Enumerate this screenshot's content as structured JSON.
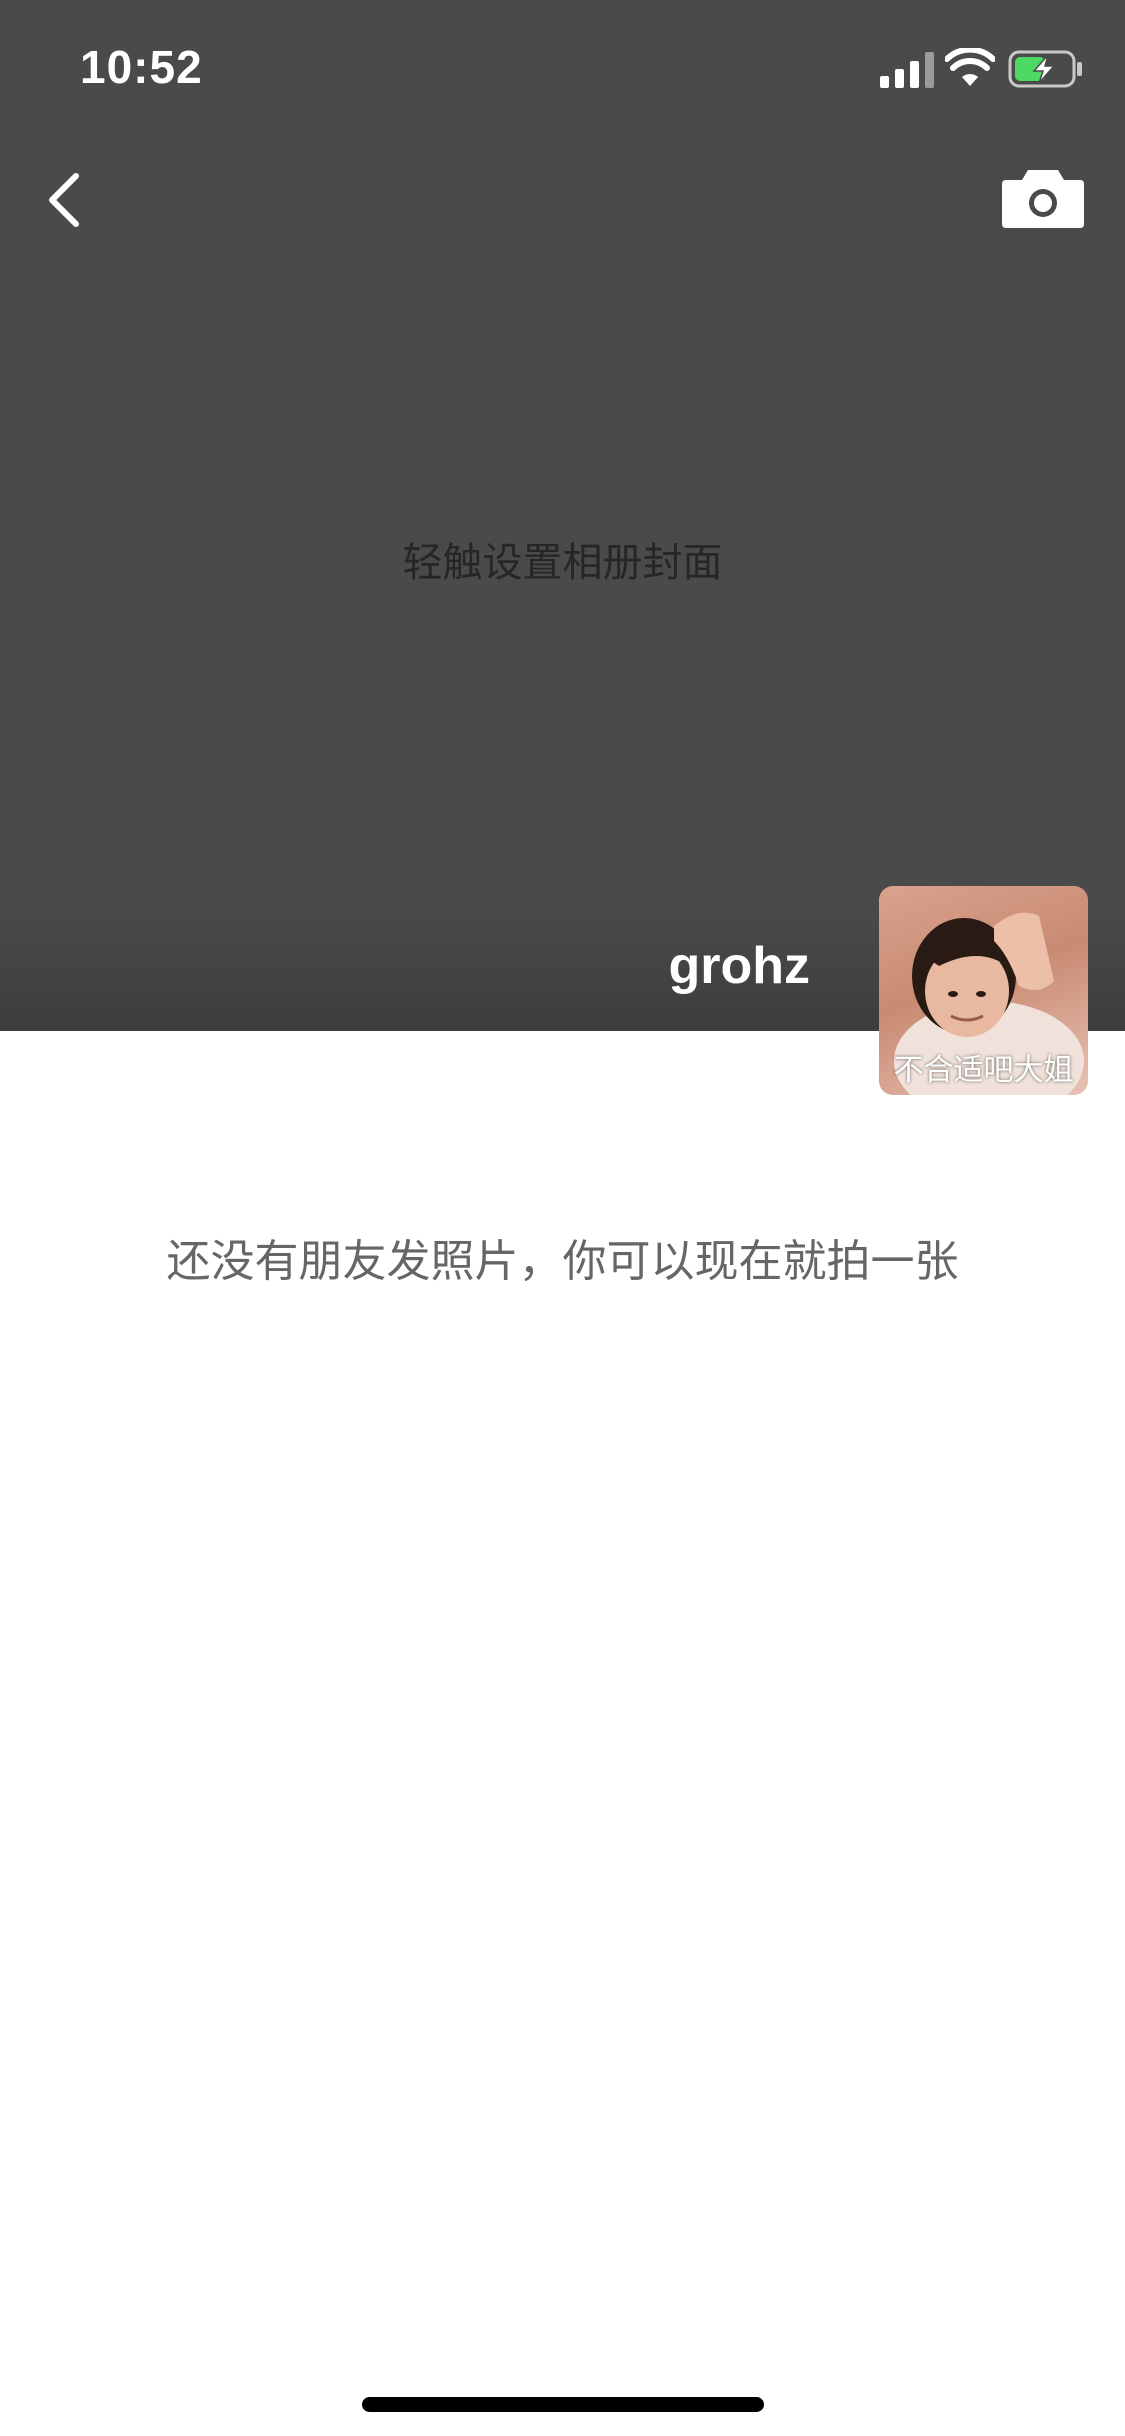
{
  "status_bar": {
    "time": "10:52"
  },
  "icons": {
    "back": "chevron-left-icon",
    "camera": "camera-icon",
    "signal": "signal-icon",
    "wifi": "wifi-icon",
    "battery": "battery-charging-icon"
  },
  "cover": {
    "hint": "轻触设置相册封面"
  },
  "profile": {
    "username": "grohz",
    "avatar_caption": "不合适吧大姐"
  },
  "feed": {
    "empty_message": "还没有朋友发照片，你可以现在就拍一张"
  },
  "colors": {
    "cover_background": "#4a4a4a",
    "battery_green": "#4cd964"
  }
}
